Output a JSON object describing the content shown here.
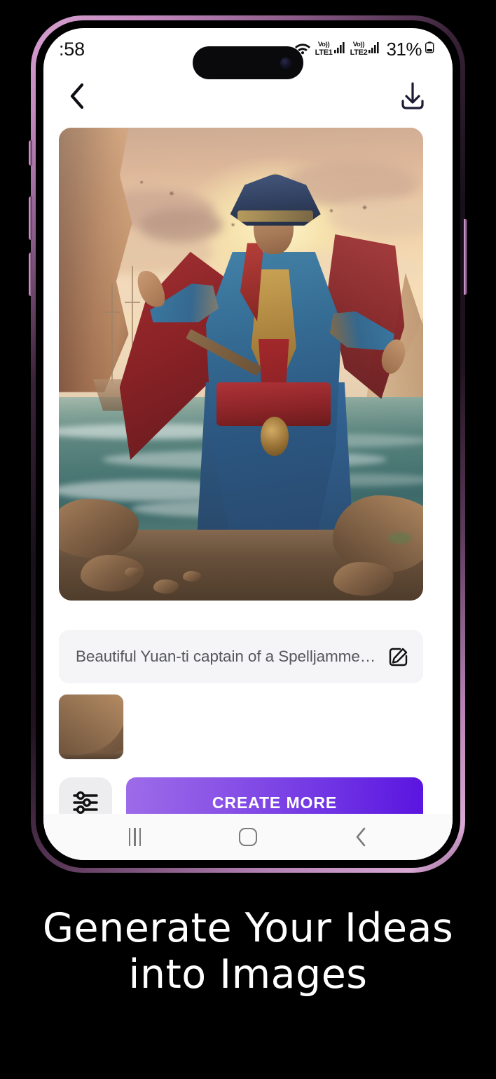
{
  "status_bar": {
    "time": ":58",
    "wifi_icon": "wifi-icon",
    "sim1": {
      "volte": "Vo))",
      "network": "LTE1",
      "signal_icon": "signal-bars-icon"
    },
    "sim2": {
      "volte": "Vo))",
      "network": "LTE2",
      "signal_icon": "signal-bars-icon"
    },
    "battery_percent": "31%",
    "battery_icon": "battery-icon"
  },
  "app_bar": {
    "back_icon": "chevron-left-icon",
    "download_icon": "download-icon"
  },
  "generated_image": {
    "alt": "Pirate captain in blue and gold coat with red cape standing on rocky shore at sunset",
    "birds": [
      "⁓",
      "⁓",
      "⁓",
      "⁓",
      "⁓"
    ]
  },
  "prompt": {
    "text": "Beautiful Yuan-ti captain of a Spelljammer …",
    "edit_icon": "edit-pencil-icon"
  },
  "thumbnails": [
    {
      "name": "thumbnail-1",
      "alt": "Pirate captain thumbnail"
    }
  ],
  "actions": {
    "settings_icon": "sliders-settings-icon",
    "create_more_label": "CREATE MORE"
  },
  "nav_bar": {
    "recents_icon": "recents-icon",
    "home_icon": "home-icon",
    "back_icon": "nav-back-icon"
  },
  "tagline": {
    "line1": "Generate Your  Ideas",
    "line2": "into  Images"
  },
  "colors": {
    "accent_start": "#9D6CE8",
    "accent_end": "#5A14E0",
    "background": "#000000",
    "screen": "#FFFFFF",
    "field_bg": "#F5F5F7",
    "frame_purple": "#C389C0",
    "text_muted": "#56575B"
  }
}
